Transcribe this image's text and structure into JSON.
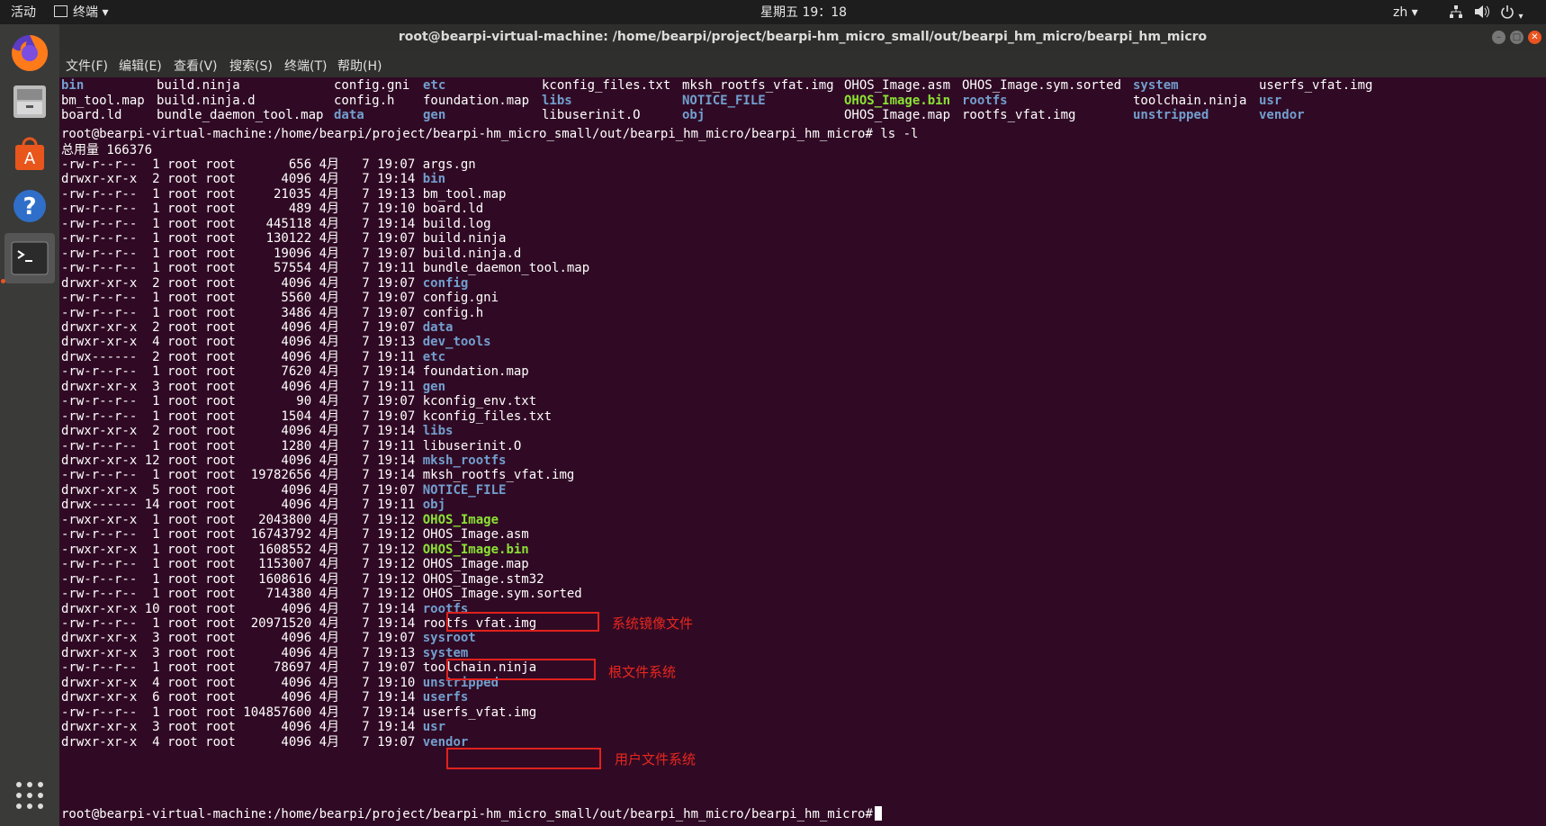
{
  "topbar": {
    "activities": "活动",
    "app_menu": "终端 ▾",
    "clock": "星期五 19：18",
    "input_method": "zh ▾"
  },
  "window": {
    "title": "root@bearpi-virtual-machine: /home/bearpi/project/bearpi-hm_micro_small/out/bearpi_hm_micro/bearpi_hm_micro"
  },
  "menu": [
    "文件(F)",
    "编辑(E)",
    "查看(V)",
    "搜索(S)",
    "终端(T)",
    "帮助(H)"
  ],
  "terminal": {
    "grid_rows": [
      [
        {
          "t": "bin",
          "c": "d"
        },
        {
          "t": "build.ninja",
          "c": ""
        },
        {
          "t": "config.gni",
          "c": ""
        },
        {
          "t": "etc",
          "c": "d"
        },
        {
          "t": "kconfig_files.txt",
          "c": ""
        },
        {
          "t": "mksh_rootfs_vfat.img",
          "c": ""
        },
        {
          "t": "OHOS_Image.asm",
          "c": ""
        },
        {
          "t": "OHOS_Image.sym.sorted",
          "c": ""
        },
        {
          "t": "system",
          "c": "d"
        },
        {
          "t": "userfs_vfat.img",
          "c": ""
        }
      ],
      [
        {
          "t": "bm_tool.map",
          "c": ""
        },
        {
          "t": "build.ninja.d",
          "c": ""
        },
        {
          "t": "config.h",
          "c": ""
        },
        {
          "t": "foundation.map",
          "c": ""
        },
        {
          "t": "libs",
          "c": "d"
        },
        {
          "t": "NOTICE_FILE",
          "c": "d"
        },
        {
          "t": "OHOS_Image.bin",
          "c": "x"
        },
        {
          "t": "rootfs",
          "c": "d"
        },
        {
          "t": "toolchain.ninja",
          "c": ""
        },
        {
          "t": "usr",
          "c": "d"
        }
      ],
      [
        {
          "t": "board.ld",
          "c": ""
        },
        {
          "t": "bundle_daemon_tool.map",
          "c": ""
        },
        {
          "t": "data",
          "c": "d"
        },
        {
          "t": "gen",
          "c": "d"
        },
        {
          "t": "libuserinit.O",
          "c": ""
        },
        {
          "t": "obj",
          "c": "d"
        },
        {
          "t": "OHOS_Image.map",
          "c": ""
        },
        {
          "t": "rootfs_vfat.img",
          "c": ""
        },
        {
          "t": "unstripped",
          "c": "d"
        },
        {
          "t": "vendor",
          "c": "d"
        }
      ]
    ],
    "prompt_cmd": "root@bearpi-virtual-machine:/home/bearpi/project/bearpi-hm_micro_small/out/bearpi_hm_micro/bearpi_hm_micro# ls -l",
    "total": "总用量 166376",
    "entries": [
      {
        "perm": "-rw-r--r--",
        "links": "1",
        "size": "656",
        "time": "19:07",
        "name": "args.gn",
        "c": ""
      },
      {
        "perm": "drwxr-xr-x",
        "links": "2",
        "size": "4096",
        "time": "19:14",
        "name": "bin",
        "c": "d"
      },
      {
        "perm": "-rw-r--r--",
        "links": "1",
        "size": "21035",
        "time": "19:13",
        "name": "bm_tool.map",
        "c": ""
      },
      {
        "perm": "-rw-r--r--",
        "links": "1",
        "size": "489",
        "time": "19:10",
        "name": "board.ld",
        "c": ""
      },
      {
        "perm": "-rw-r--r--",
        "links": "1",
        "size": "445118",
        "time": "19:14",
        "name": "build.log",
        "c": ""
      },
      {
        "perm": "-rw-r--r--",
        "links": "1",
        "size": "130122",
        "time": "19:07",
        "name": "build.ninja",
        "c": ""
      },
      {
        "perm": "-rw-r--r--",
        "links": "1",
        "size": "19096",
        "time": "19:07",
        "name": "build.ninja.d",
        "c": ""
      },
      {
        "perm": "-rw-r--r--",
        "links": "1",
        "size": "57554",
        "time": "19:11",
        "name": "bundle_daemon_tool.map",
        "c": ""
      },
      {
        "perm": "drwxr-xr-x",
        "links": "2",
        "size": "4096",
        "time": "19:07",
        "name": "config",
        "c": "d"
      },
      {
        "perm": "-rw-r--r--",
        "links": "1",
        "size": "5560",
        "time": "19:07",
        "name": "config.gni",
        "c": ""
      },
      {
        "perm": "-rw-r--r--",
        "links": "1",
        "size": "3486",
        "time": "19:07",
        "name": "config.h",
        "c": ""
      },
      {
        "perm": "drwxr-xr-x",
        "links": "2",
        "size": "4096",
        "time": "19:07",
        "name": "data",
        "c": "d"
      },
      {
        "perm": "drwxr-xr-x",
        "links": "4",
        "size": "4096",
        "time": "19:13",
        "name": "dev_tools",
        "c": "d"
      },
      {
        "perm": "drwx------",
        "links": "2",
        "size": "4096",
        "time": "19:11",
        "name": "etc",
        "c": "d"
      },
      {
        "perm": "-rw-r--r--",
        "links": "1",
        "size": "7620",
        "time": "19:14",
        "name": "foundation.map",
        "c": ""
      },
      {
        "perm": "drwxr-xr-x",
        "links": "3",
        "size": "4096",
        "time": "19:11",
        "name": "gen",
        "c": "d"
      },
      {
        "perm": "-rw-r--r--",
        "links": "1",
        "size": "90",
        "time": "19:07",
        "name": "kconfig_env.txt",
        "c": ""
      },
      {
        "perm": "-rw-r--r--",
        "links": "1",
        "size": "1504",
        "time": "19:07",
        "name": "kconfig_files.txt",
        "c": ""
      },
      {
        "perm": "drwxr-xr-x",
        "links": "2",
        "size": "4096",
        "time": "19:14",
        "name": "libs",
        "c": "d"
      },
      {
        "perm": "-rw-r--r--",
        "links": "1",
        "size": "1280",
        "time": "19:11",
        "name": "libuserinit.O",
        "c": ""
      },
      {
        "perm": "drwxr-xr-x",
        "links": "12",
        "size": "4096",
        "time": "19:14",
        "name": "mksh_rootfs",
        "c": "d"
      },
      {
        "perm": "-rw-r--r--",
        "links": "1",
        "size": "19782656",
        "time": "19:14",
        "name": "mksh_rootfs_vfat.img",
        "c": ""
      },
      {
        "perm": "drwxr-xr-x",
        "links": "5",
        "size": "4096",
        "time": "19:07",
        "name": "NOTICE_FILE",
        "c": "d"
      },
      {
        "perm": "drwx------",
        "links": "14",
        "size": "4096",
        "time": "19:11",
        "name": "obj",
        "c": "d"
      },
      {
        "perm": "-rwxr-xr-x",
        "links": "1",
        "size": "2043800",
        "time": "19:12",
        "name": "OHOS_Image",
        "c": "x"
      },
      {
        "perm": "-rw-r--r--",
        "links": "1",
        "size": "16743792",
        "time": "19:12",
        "name": "OHOS_Image.asm",
        "c": ""
      },
      {
        "perm": "-rwxr-xr-x",
        "links": "1",
        "size": "1608552",
        "time": "19:12",
        "name": "OHOS_Image.bin",
        "c": "x"
      },
      {
        "perm": "-rw-r--r--",
        "links": "1",
        "size": "1153007",
        "time": "19:12",
        "name": "OHOS_Image.map",
        "c": ""
      },
      {
        "perm": "-rw-r--r--",
        "links": "1",
        "size": "1608616",
        "time": "19:12",
        "name": "OHOS_Image.stm32",
        "c": ""
      },
      {
        "perm": "-rw-r--r--",
        "links": "1",
        "size": "714380",
        "time": "19:12",
        "name": "OHOS_Image.sym.sorted",
        "c": ""
      },
      {
        "perm": "drwxr-xr-x",
        "links": "10",
        "size": "4096",
        "time": "19:14",
        "name": "rootfs",
        "c": "d"
      },
      {
        "perm": "-rw-r--r--",
        "links": "1",
        "size": "20971520",
        "time": "19:14",
        "name": "rootfs_vfat.img",
        "c": ""
      },
      {
        "perm": "drwxr-xr-x",
        "links": "3",
        "size": "4096",
        "time": "19:07",
        "name": "sysroot",
        "c": "d"
      },
      {
        "perm": "drwxr-xr-x",
        "links": "3",
        "size": "4096",
        "time": "19:13",
        "name": "system",
        "c": "d"
      },
      {
        "perm": "-rw-r--r--",
        "links": "1",
        "size": "78697",
        "time": "19:07",
        "name": "toolchain.ninja",
        "c": ""
      },
      {
        "perm": "drwxr-xr-x",
        "links": "4",
        "size": "4096",
        "time": "19:10",
        "name": "unstripped",
        "c": "d"
      },
      {
        "perm": "drwxr-xr-x",
        "links": "6",
        "size": "4096",
        "time": "19:14",
        "name": "userfs",
        "c": "d"
      },
      {
        "perm": "-rw-r--r--",
        "links": "1",
        "size": "104857600",
        "time": "19:14",
        "name": "userfs_vfat.img",
        "c": ""
      },
      {
        "perm": "drwxr-xr-x",
        "links": "3",
        "size": "4096",
        "time": "19:14",
        "name": "usr",
        "c": "d"
      },
      {
        "perm": "drwxr-xr-x",
        "links": "4",
        "size": "4096",
        "time": "19:07",
        "name": "vendor",
        "c": "d"
      }
    ],
    "date_prefix": "4月   7",
    "owner": "root root",
    "final_prompt": "root@bearpi-virtual-machine:/home/bearpi/project/bearpi-hm_micro_small/out/bearpi_hm_micro/bearpi_hm_micro#"
  },
  "annotations": {
    "stm32_note": "系统镜像文件",
    "rootfs_note": "根文件系统",
    "userfs_note": "用户文件系统"
  },
  "colors": {
    "terminal_bg": "#300a24",
    "directory": "#729fcf",
    "executable": "#8ae234",
    "annotation_red": "#e0211d"
  }
}
